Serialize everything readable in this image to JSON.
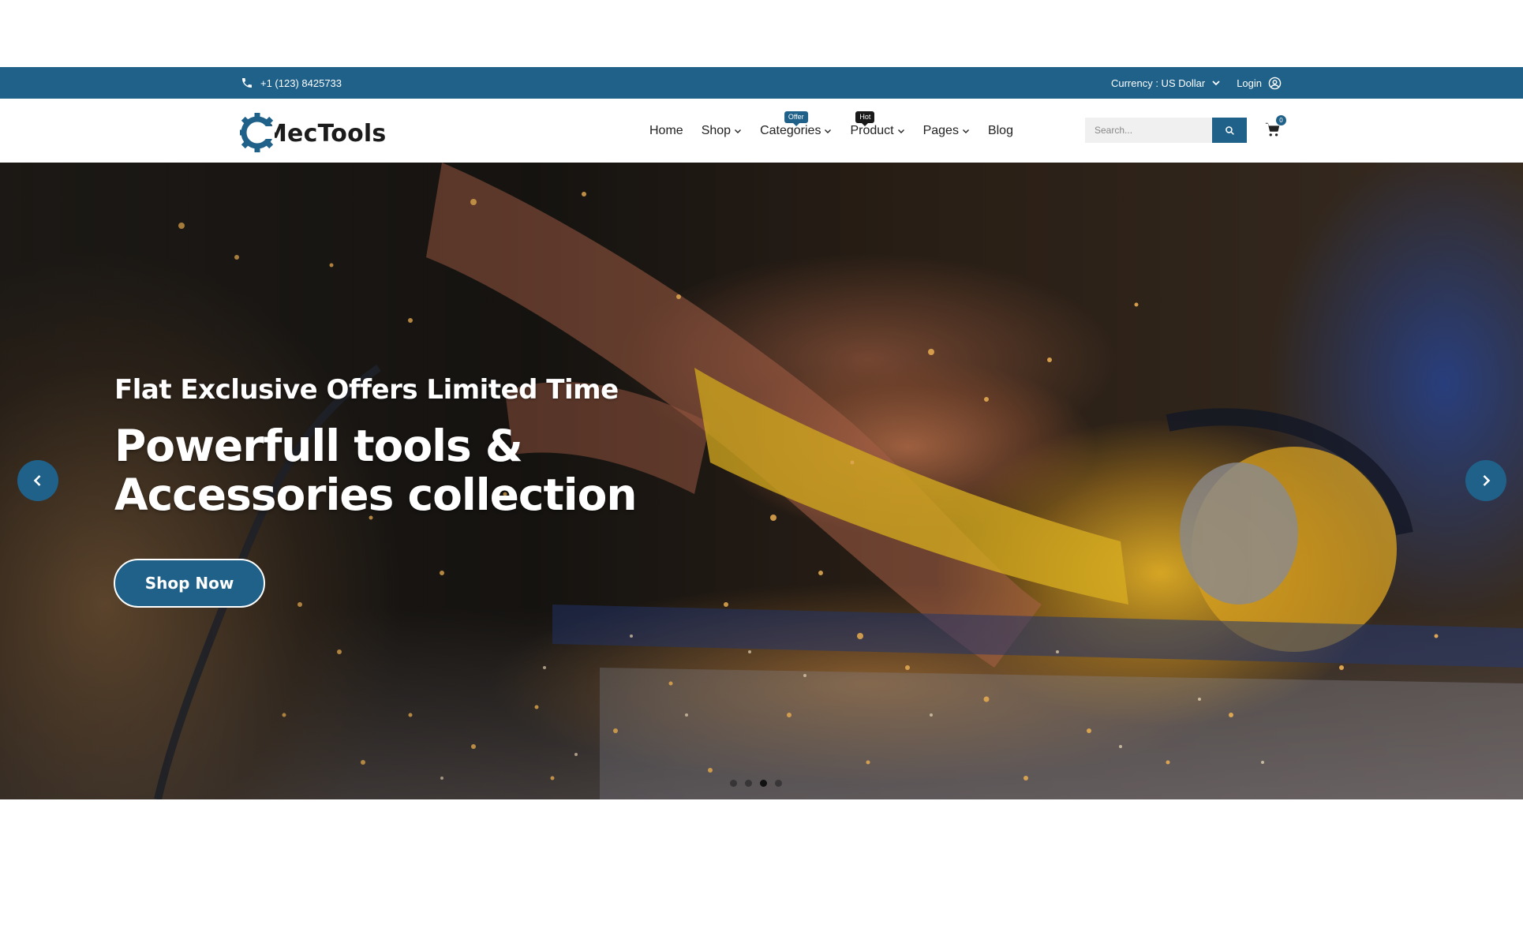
{
  "topbar": {
    "phone": "+1 (123) 8425733",
    "currency": "Currency : US Dollar",
    "login": "Login"
  },
  "header": {
    "logo": "MecTools",
    "nav": [
      {
        "label": "Home"
      },
      {
        "label": "Shop"
      },
      {
        "label": "Categories",
        "badge": "Offer"
      },
      {
        "label": "Product",
        "badge": "Hot"
      },
      {
        "label": "Pages"
      },
      {
        "label": "Blog"
      }
    ],
    "search_placeholder": "Search...",
    "cart_count": "0"
  },
  "hero": {
    "subtitle": "Flat Exclusive Offers Limited Time",
    "title": "Powerfull tools & Accessories collection",
    "button": "Shop Now"
  },
  "colors": {
    "primary": "#1f6189",
    "hot_badge": "#1a1a1a"
  },
  "icons": [
    "phone-icon",
    "chevron-down-icon",
    "user-circle-icon",
    "search-icon",
    "cart-icon",
    "arrow-left-icon",
    "arrow-right-icon",
    "gear-icon"
  ]
}
